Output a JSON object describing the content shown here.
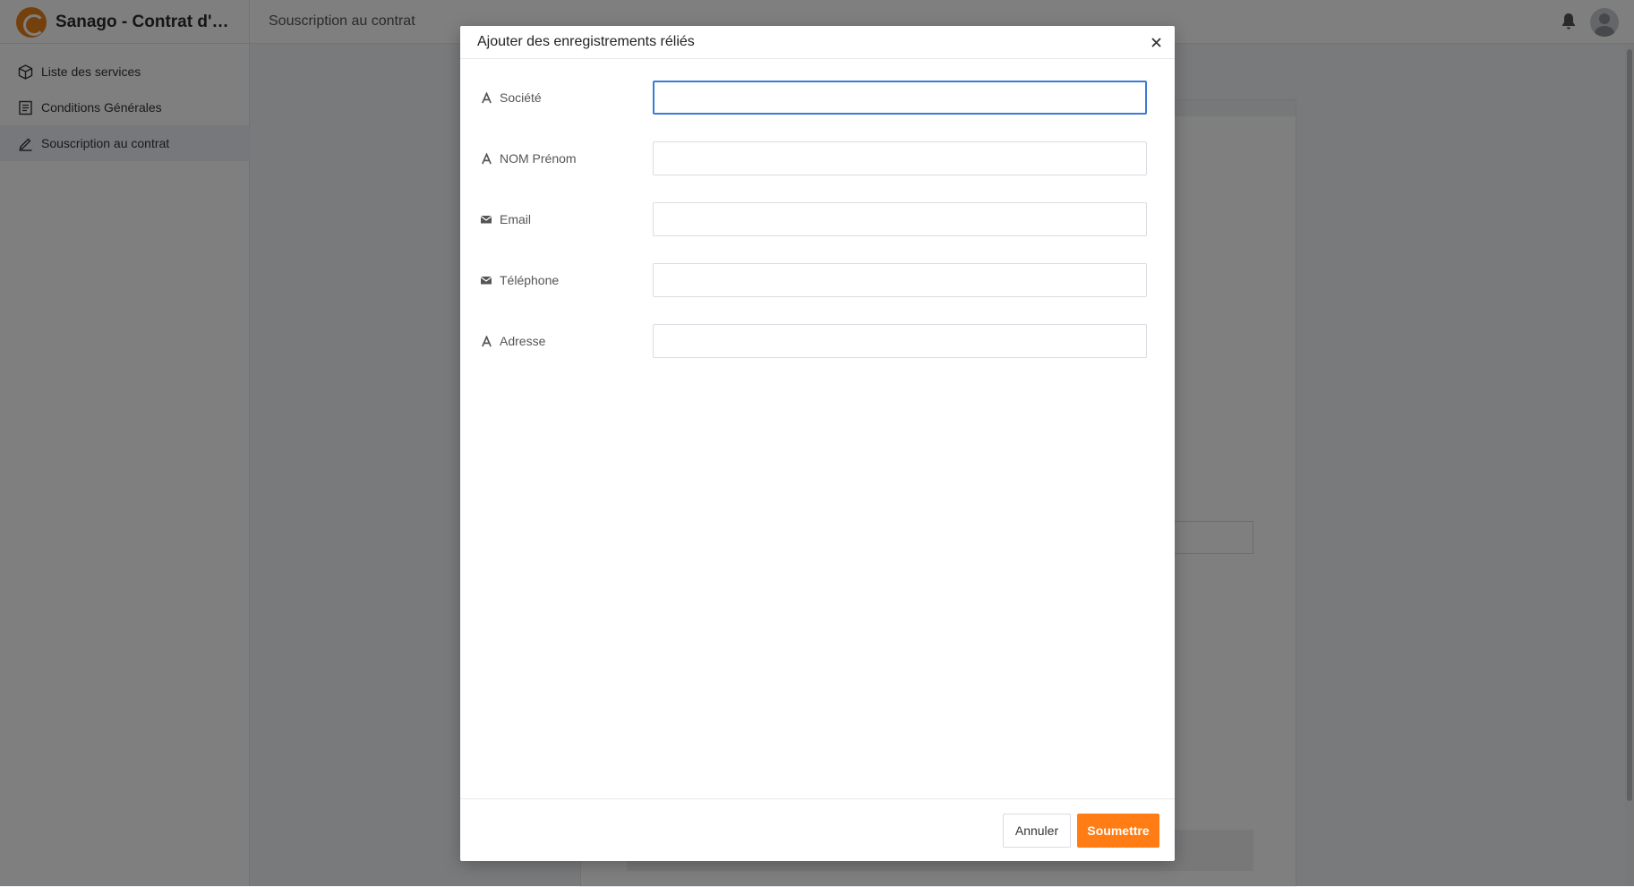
{
  "app": {
    "title": "Sanago - Contrat d'ab...",
    "breadcrumb": "Souscription au contrat",
    "sidebar": {
      "items": [
        {
          "label": "Liste des services",
          "icon": "cube-icon"
        },
        {
          "label": "Conditions Générales",
          "icon": "document-icon"
        },
        {
          "label": "Souscription au contrat",
          "icon": "edit-icon"
        }
      ]
    }
  },
  "modal": {
    "title": "Ajouter des enregistrements réliés",
    "fields": [
      {
        "label": "Société",
        "icon": "text-icon",
        "value": "",
        "focused": true
      },
      {
        "label": "NOM Prénom",
        "icon": "text-icon",
        "value": ""
      },
      {
        "label": "Email",
        "icon": "envelope-icon",
        "value": ""
      },
      {
        "label": "Téléphone",
        "icon": "envelope-icon",
        "value": ""
      },
      {
        "label": "Adresse",
        "icon": "text-icon",
        "value": ""
      }
    ],
    "buttons": {
      "cancel": "Annuler",
      "submit": "Soumettre"
    }
  },
  "colors": {
    "primary": "#ff7d14",
    "focus": "#3a7bd5",
    "overlay": "rgba(0,0,0,0.5)"
  }
}
